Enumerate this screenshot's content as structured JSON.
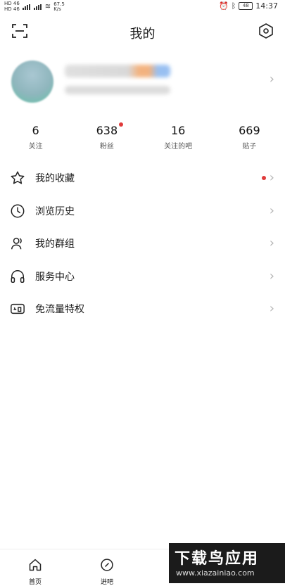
{
  "status_bar": {
    "left_line1": "HD 46",
    "left_line2": "HD 46",
    "speed_value": "67.5",
    "speed_unit": "K/s",
    "battery": "48",
    "time": "14:37"
  },
  "header": {
    "title": "我的"
  },
  "stats": [
    {
      "num": "6",
      "label": "关注"
    },
    {
      "num": "638",
      "label": "粉丝"
    },
    {
      "num": "16",
      "label": "关注的吧"
    },
    {
      "num": "669",
      "label": "贴子"
    }
  ],
  "menu": [
    {
      "label": "我的收藏",
      "icon": "star-icon"
    },
    {
      "label": "浏览历史",
      "icon": "clock-icon"
    },
    {
      "label": "我的群组",
      "icon": "group-icon"
    },
    {
      "label": "服务中心",
      "icon": "headphones-icon"
    },
    {
      "label": "免流量特权",
      "icon": "free-data-icon"
    }
  ],
  "bottom_nav": [
    {
      "label": "首页",
      "icon": "home-icon"
    },
    {
      "label": "进吧",
      "icon": "compass-icon"
    }
  ],
  "watermark": {
    "big": "下载鸟应用",
    "small": "www.xiazainiao.com"
  },
  "colors": {
    "badge_dot": "#e03b3b",
    "chevron": "#b5b5b5"
  }
}
